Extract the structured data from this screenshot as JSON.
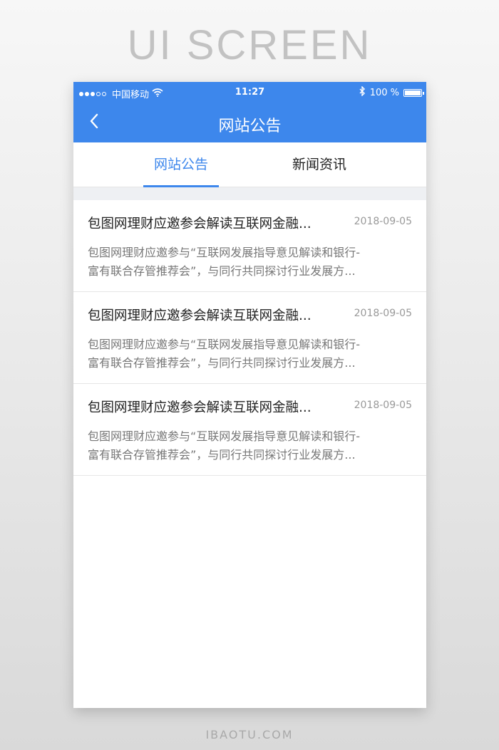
{
  "page": {
    "heading": "UI SCREEN",
    "footer": "IBAOTU.COM"
  },
  "status_bar": {
    "carrier": "中国移动",
    "time": "11:27",
    "battery": "100 %",
    "battery_level": 1.0,
    "icons": [
      "signal-icon",
      "wifi-icon",
      "bluetooth-icon",
      "battery-icon"
    ]
  },
  "nav": {
    "title": "网站公告",
    "back_icon": "chevron-left-icon"
  },
  "tabs": [
    {
      "label": "网站公告",
      "active": true
    },
    {
      "label": "新闻资讯",
      "active": false
    }
  ],
  "news": [
    {
      "title": "包图网理财应邀参会解读互联网金融...",
      "date": "2018-09-05",
      "summary_line1": "包图网理财应邀参与“互联网发展指导意见解读和银行-",
      "summary_line2": "富有联合存管推荐会”，与同行共同探讨行业发展方..."
    },
    {
      "title": "包图网理财应邀参会解读互联网金融...",
      "date": "2018-09-05",
      "summary_line1": "包图网理财应邀参与“互联网发展指导意见解读和银行-",
      "summary_line2": "富有联合存管推荐会”，与同行共同探讨行业发展方..."
    },
    {
      "title": "包图网理财应邀参会解读互联网金融...",
      "date": "2018-09-05",
      "summary_line1": "包图网理财应邀参与“互联网发展指导意见解读和银行-",
      "summary_line2": "富有联合存管推荐会”，与同行共同探讨行业发展方..."
    }
  ],
  "colors": {
    "accent": "#3d87ec",
    "title_text": "#222222",
    "summary_text": "#777777",
    "date_text": "#999999"
  }
}
